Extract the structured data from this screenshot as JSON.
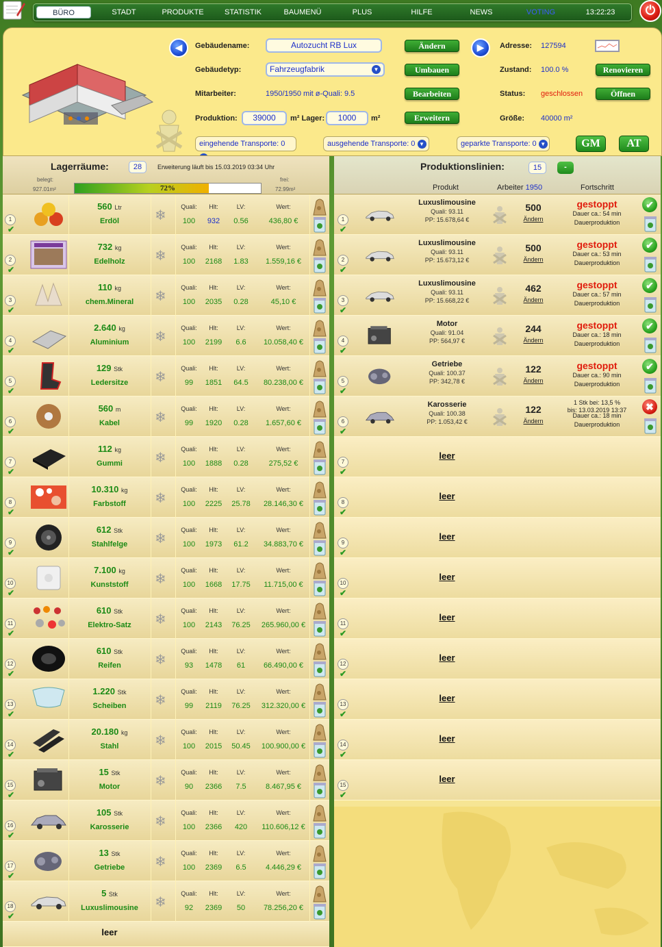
{
  "nav": {
    "items": [
      "BÜRO",
      "STADT",
      "PRODUKTE",
      "STATISTIK",
      "BAUMENÜ",
      "PLUS",
      "HILFE",
      "NEWS",
      "VOTING"
    ],
    "time": "13:22:23"
  },
  "header": {
    "name_label": "Gebäudename:",
    "name_value": "Autozucht RB Lux",
    "change_btn": "Ändern",
    "type_label": "Gebäudetyp:",
    "type_value": "Fahrzeugfabrik",
    "rebuild_btn": "Umbauen",
    "staff_label": "Mitarbeiter:",
    "staff_value": "1950/1950 mit ø-Quali:",
    "staff_quali": "9.5",
    "edit_btn": "Bearbeiten",
    "prod_label": "Produktion:",
    "prod_value": "39000",
    "storage_label": "m² Lager:",
    "storage_value": "1000",
    "m2": "m²",
    "expand_btn": "Erweitern",
    "addr_label": "Adresse:",
    "addr_value": "127594",
    "cond_label": "Zustand:",
    "cond_value": "100.0 %",
    "renovate_btn": "Renovieren",
    "status_label": "Status:",
    "status_value": "geschlossen",
    "open_btn": "Öffnen",
    "size_label": "Größe:",
    "size_value": "40000 m²",
    "in_transport": "eingehende Transporte: 0",
    "out_transport": "ausgehende Transporte: 0",
    "parked_transport": "geparkte Transporte: 0",
    "gm": "GM",
    "at": "AT"
  },
  "storage": {
    "title": "Lagerräume:",
    "count": "28",
    "expansion": "Erweiterung läuft bis 15.03.2019 03:34 Uhr",
    "used_label": "belegt:",
    "used_value": "927.01m²",
    "free_label": "frei:",
    "free_value": "72.99m²",
    "fill_percent": "72%",
    "fill_fraction": 0.72,
    "col_quali": "Quali:",
    "col_hlt": "Hlt:",
    "col_lv": "LV:",
    "col_wert": "Wert:",
    "rows": [
      {
        "n": "1",
        "amount": "560",
        "unit": "Ltr",
        "name": "Erdöl",
        "quali": "100",
        "hlt": "932",
        "lv": "0.56",
        "wert": "436,80 €"
      },
      {
        "n": "2",
        "amount": "732",
        "unit": "kg",
        "name": "Edelholz",
        "quali": "100",
        "hlt": "2168",
        "lv": "1.83",
        "wert": "1.559,16 €"
      },
      {
        "n": "3",
        "amount": "110",
        "unit": "kg",
        "name": "chem.Mineral",
        "quali": "100",
        "hlt": "2035",
        "lv": "0.28",
        "wert": "45,10 €"
      },
      {
        "n": "4",
        "amount": "2.640",
        "unit": "kg",
        "name": "Aluminium",
        "quali": "100",
        "hlt": "2199",
        "lv": "6.6",
        "wert": "10.058,40 €"
      },
      {
        "n": "5",
        "amount": "129",
        "unit": "Stk",
        "name": "Ledersitze",
        "quali": "99",
        "hlt": "1851",
        "lv": "64.5",
        "wert": "80.238,00 €"
      },
      {
        "n": "6",
        "amount": "560",
        "unit": "m",
        "name": "Kabel",
        "quali": "99",
        "hlt": "1920",
        "lv": "0.28",
        "wert": "1.657,60 €"
      },
      {
        "n": "7",
        "amount": "112",
        "unit": "kg",
        "name": "Gummi",
        "quali": "100",
        "hlt": "1888",
        "lv": "0.28",
        "wert": "275,52 €"
      },
      {
        "n": "8",
        "amount": "10.310",
        "unit": "kg",
        "name": "Farbstoff",
        "quali": "100",
        "hlt": "2225",
        "lv": "25.78",
        "wert": "28.146,30 €"
      },
      {
        "n": "9",
        "amount": "612",
        "unit": "Stk",
        "name": "Stahlfelge",
        "quali": "100",
        "hlt": "1973",
        "lv": "61.2",
        "wert": "34.883,70 €"
      },
      {
        "n": "10",
        "amount": "7.100",
        "unit": "kg",
        "name": "Kunststoff",
        "quali": "100",
        "hlt": "1668",
        "lv": "17.75",
        "wert": "11.715,00 €"
      },
      {
        "n": "11",
        "amount": "610",
        "unit": "Stk",
        "name": "Elektro-Satz",
        "quali": "100",
        "hlt": "2143",
        "lv": "76.25",
        "wert": "265.960,00 €"
      },
      {
        "n": "12",
        "amount": "610",
        "unit": "Stk",
        "name": "Reifen",
        "quali": "93",
        "hlt": "1478",
        "lv": "61",
        "wert": "66.490,00 €"
      },
      {
        "n": "13",
        "amount": "1.220",
        "unit": "Stk",
        "name": "Scheiben",
        "quali": "99",
        "hlt": "2119",
        "lv": "76.25",
        "wert": "312.320,00 €"
      },
      {
        "n": "14",
        "amount": "20.180",
        "unit": "kg",
        "name": "Stahl",
        "quali": "100",
        "hlt": "2015",
        "lv": "50.45",
        "wert": "100.900,00 €"
      },
      {
        "n": "15",
        "amount": "15",
        "unit": "Stk",
        "name": "Motor",
        "quali": "90",
        "hlt": "2366",
        "lv": "7.5",
        "wert": "8.467,95 €"
      },
      {
        "n": "16",
        "amount": "105",
        "unit": "Stk",
        "name": "Karosserie",
        "quali": "100",
        "hlt": "2366",
        "lv": "420",
        "wert": "110.606,12 €"
      },
      {
        "n": "17",
        "amount": "13",
        "unit": "Stk",
        "name": "Getriebe",
        "quali": "100",
        "hlt": "2369",
        "lv": "6.5",
        "wert": "4.446,29 €"
      },
      {
        "n": "18",
        "amount": "5",
        "unit": "Stk",
        "name": "Luxuslimousine",
        "quali": "92",
        "hlt": "2369",
        "lv": "50",
        "wert": "78.256,20 €"
      }
    ],
    "last_row": "leer",
    "icons": [
      "oil-barrels-icon",
      "wood-planks-icon",
      "mineral-crystal-icon",
      "aluminium-sheet-icon",
      "leather-seat-icon",
      "cable-reel-icon",
      "rubber-block-icon",
      "dye-swatch-icon",
      "steel-rim-icon",
      "plastic-roll-icon",
      "electric-set-icon",
      "tire-icon",
      "windshield-icon",
      "steel-beam-icon",
      "engine-icon",
      "car-body-icon",
      "gearbox-icon",
      "limousine-icon"
    ]
  },
  "production": {
    "title": "Produktionslinien:",
    "count": "15",
    "minus_btn": "-",
    "col_product": "Produkt",
    "col_workers": "Arbeiter",
    "workers_total": "1950",
    "col_progress": "Fortschritt",
    "lines": [
      {
        "n": "1",
        "product": "Luxuslimousine",
        "quali": "Quali: 93.11",
        "pp": "PP: 15.678,64 €",
        "workers": "500",
        "change": "Ändern",
        "status": "gestoppt",
        "duration": "Dauer ca.: 54 min",
        "mode": "Dauerproduktion",
        "ok": true
      },
      {
        "n": "2",
        "product": "Luxuslimousine",
        "quali": "Quali: 93.11",
        "pp": "PP: 15.673,12 €",
        "workers": "500",
        "change": "Ändern",
        "status": "gestoppt",
        "duration": "Dauer ca.: 53 min",
        "mode": "Dauerproduktion",
        "ok": true
      },
      {
        "n": "3",
        "product": "Luxuslimousine",
        "quali": "Quali: 93.11",
        "pp": "PP: 15.668,22 €",
        "workers": "462",
        "change": "Ändern",
        "status": "gestoppt",
        "duration": "Dauer ca.: 57 min",
        "mode": "Dauerproduktion",
        "ok": true
      },
      {
        "n": "4",
        "product": "Motor",
        "quali": "Quali: 91.04",
        "pp": "PP: 564,97 €",
        "workers": "244",
        "change": "Ändern",
        "status": "gestoppt",
        "duration": "Dauer ca.: 18 min",
        "mode": "Dauerproduktion",
        "ok": true
      },
      {
        "n": "5",
        "product": "Getriebe",
        "quali": "Quali: 100.37",
        "pp": "PP: 342,78 €",
        "workers": "122",
        "change": "Ändern",
        "status": "gestoppt",
        "duration": "Dauer ca.: 90 min",
        "mode": "Dauerproduktion",
        "ok": true
      },
      {
        "n": "6",
        "product": "Karosserie",
        "quali": "Quali: 100.38",
        "pp": "PP: 1.053,42 €",
        "workers": "122",
        "change": "Ändern",
        "status": "1 Stk bei: 13,5 %",
        "until": "bis: 13.03.2019 13:37",
        "duration": "Dauer ca.: 18 min",
        "mode": "Dauerproduktion",
        "ok": false
      }
    ],
    "empty_label": "leer",
    "empty_lines": [
      "7",
      "8",
      "9",
      "10",
      "11",
      "12",
      "13",
      "14",
      "15"
    ]
  }
}
